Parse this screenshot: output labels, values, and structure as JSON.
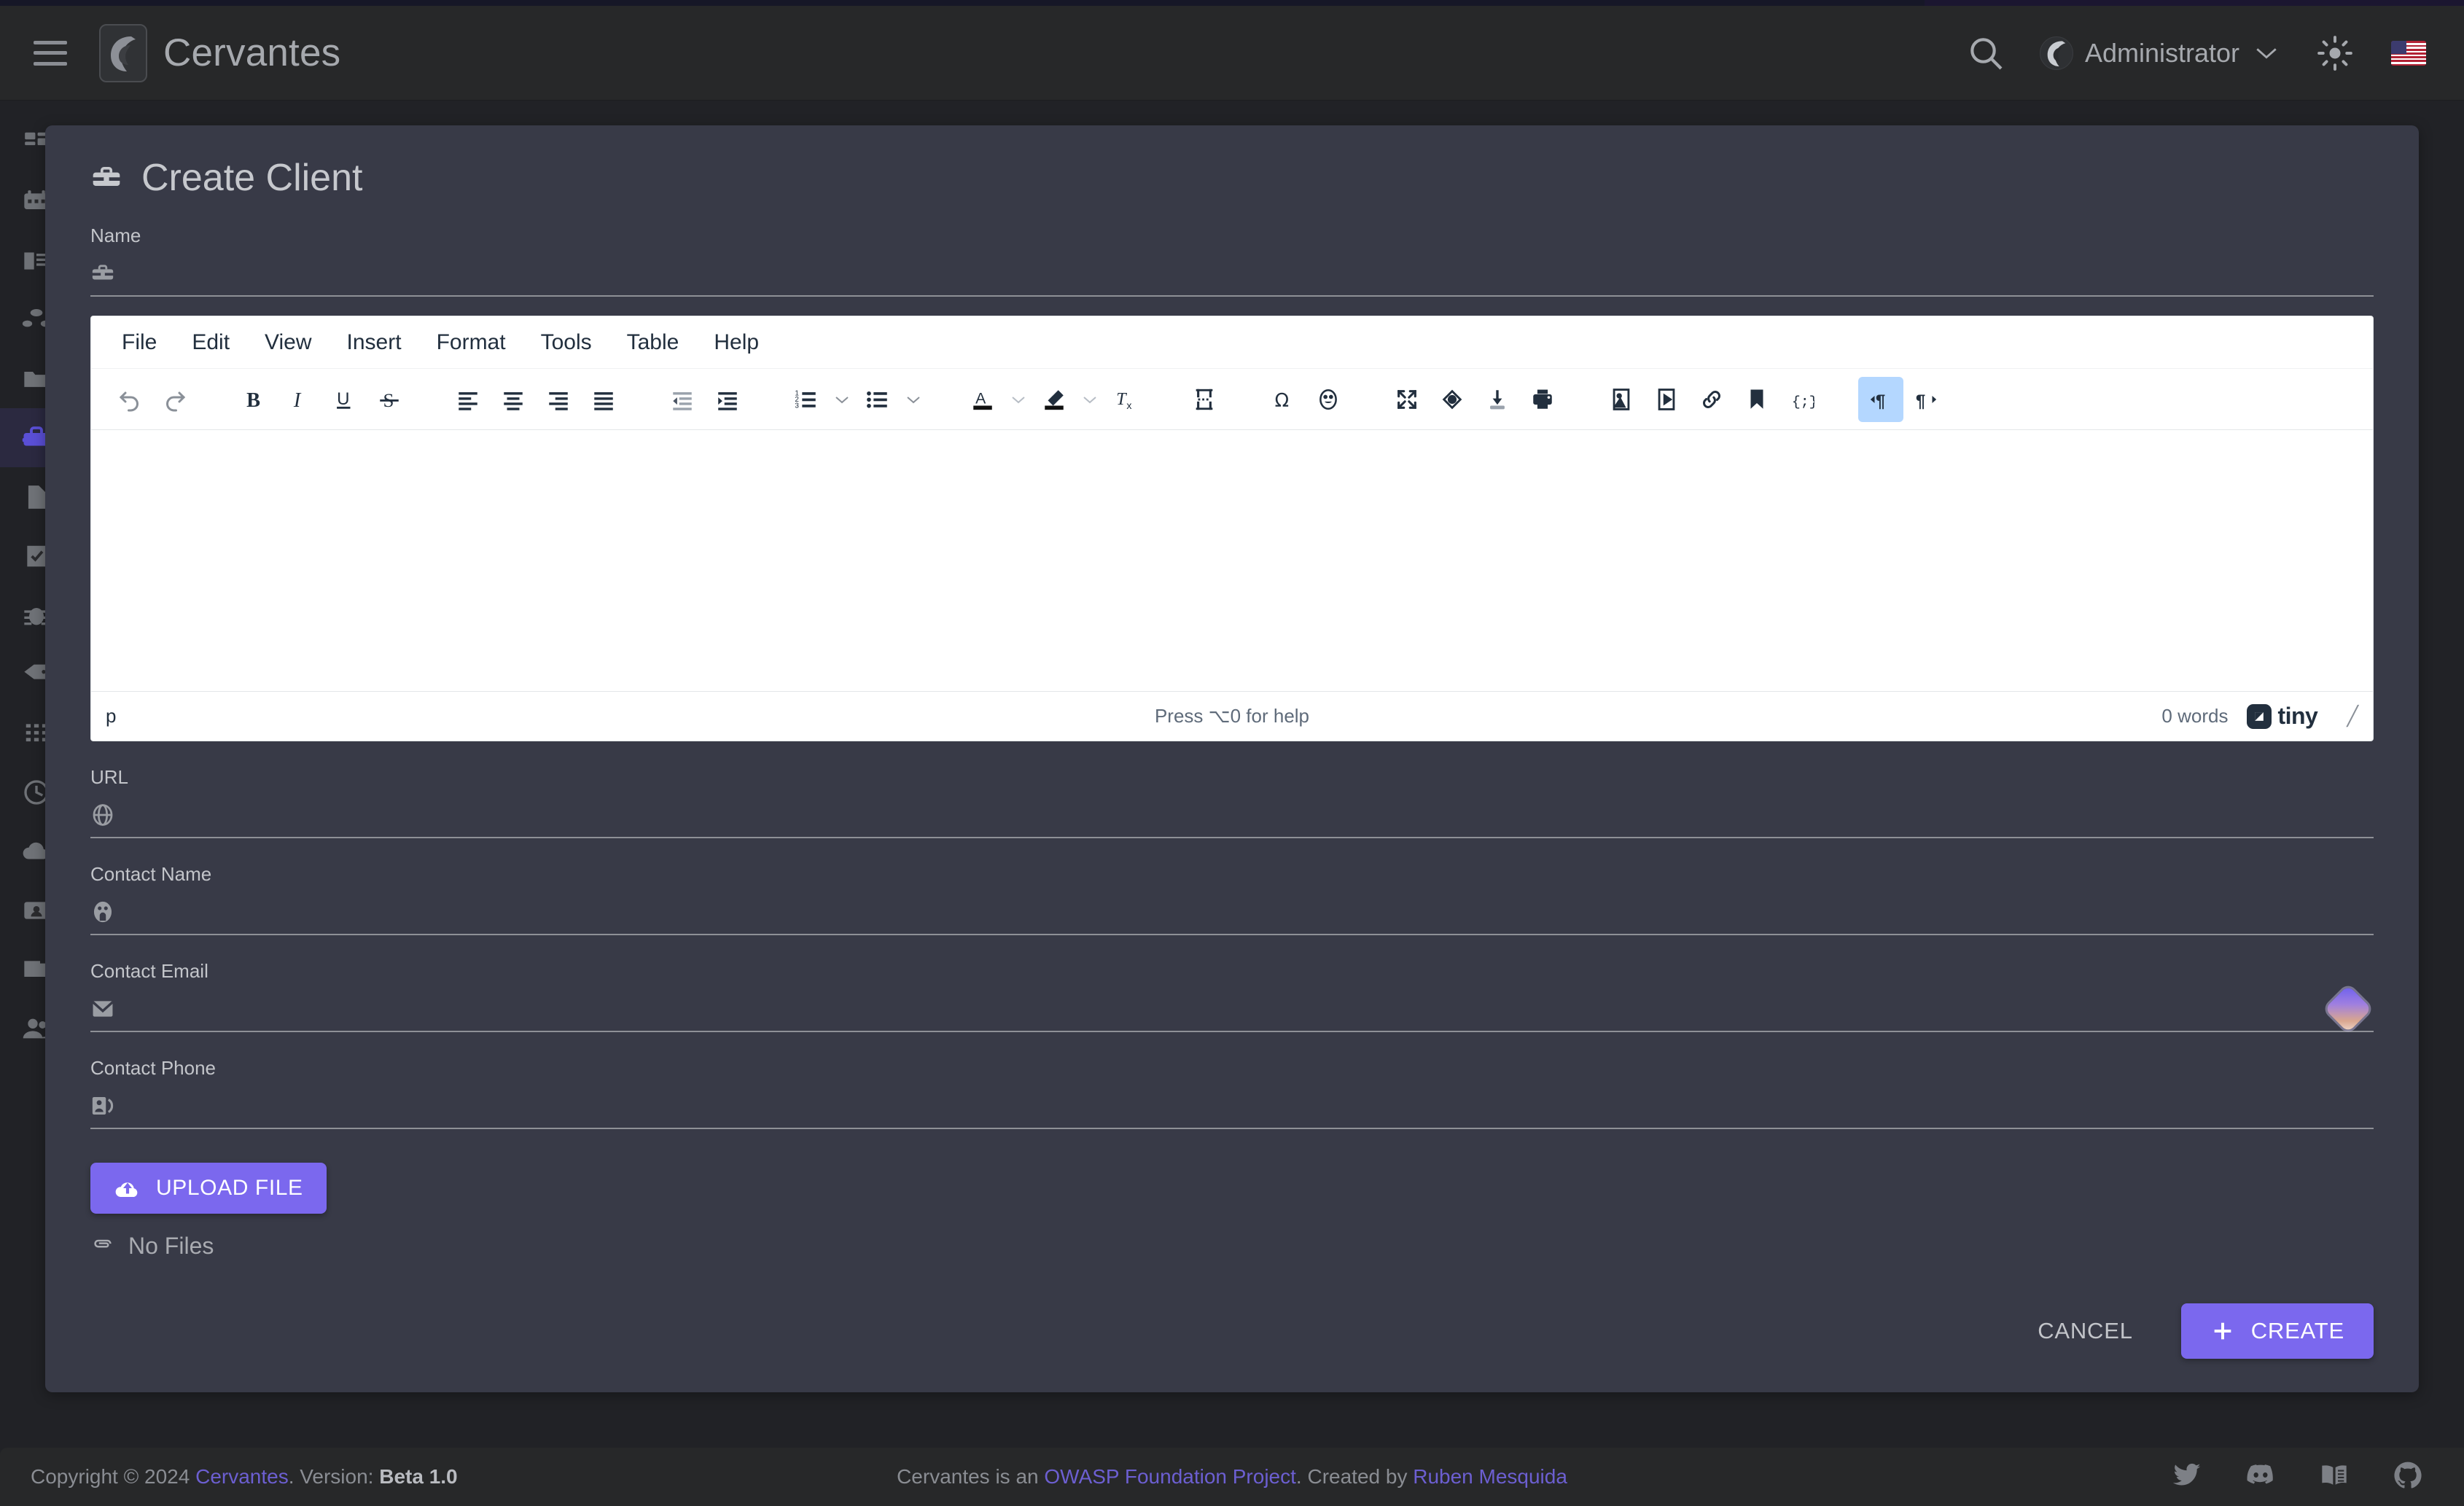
{
  "header": {
    "menu_icon": "hamburger-icon",
    "brand": "Cervantes",
    "search_icon": "search-icon",
    "user": "Administrator",
    "chevron": "chevron-down-icon",
    "theme_icon": "sun-icon",
    "language_flag": "us-flag-icon"
  },
  "sidebar": {
    "items": [
      {
        "name": "dashboard",
        "icon": "dashboard-grid-icon",
        "active": false
      },
      {
        "name": "calendar",
        "icon": "calendar-icon",
        "active": false
      },
      {
        "name": "projects",
        "icon": "book-icon",
        "active": false
      },
      {
        "name": "network",
        "icon": "nodes-icon",
        "active": false
      },
      {
        "name": "folders",
        "icon": "folder-icon",
        "active": false
      },
      {
        "name": "clients",
        "icon": "briefcase-icon",
        "active": true
      },
      {
        "name": "documents",
        "icon": "document-icon",
        "active": false
      },
      {
        "name": "checklists",
        "icon": "document-check-icon",
        "active": false
      },
      {
        "name": "vulnerabilities",
        "icon": "bug-icon",
        "active": false
      },
      {
        "name": "tags",
        "icon": "tag-icon",
        "active": false
      },
      {
        "name": "apps",
        "icon": "grid-dots-icon",
        "active": false
      },
      {
        "name": "history",
        "icon": "clock-icon",
        "active": false
      },
      {
        "name": "uploads",
        "icon": "cloud-upload-icon",
        "active": false
      },
      {
        "name": "id-cards",
        "icon": "id-card-icon",
        "active": false
      },
      {
        "name": "reports",
        "icon": "reports-icon",
        "active": false
      },
      {
        "name": "users",
        "icon": "users-icon",
        "active": false
      }
    ]
  },
  "page": {
    "title": "Create Client",
    "title_icon": "briefcase-icon"
  },
  "form": {
    "fields": [
      {
        "label": "Name",
        "icon": "briefcase-icon",
        "value": "",
        "placeholder": ""
      },
      {
        "label": "URL",
        "icon": "globe-icon",
        "value": "",
        "placeholder": ""
      },
      {
        "label": "Contact Name",
        "icon": "contact-face-icon",
        "value": "",
        "placeholder": ""
      },
      {
        "label": "Contact Email",
        "icon": "envelope-icon",
        "value": "",
        "placeholder": ""
      },
      {
        "label": "Contact Phone",
        "icon": "contact-card-icon",
        "value": "",
        "placeholder": ""
      }
    ],
    "grammar_badge": "grammarly-diamond-icon",
    "upload_button": "UPLOAD FILE",
    "upload_icon": "cloud-upload-icon",
    "files_icon": "paperclip-icon",
    "files_status": "No Files",
    "cancel_button": "CANCEL",
    "create_button": "CREATE",
    "create_icon": "plus-icon"
  },
  "editor": {
    "menus": [
      "File",
      "Edit",
      "View",
      "Insert",
      "Format",
      "Tools",
      "Table",
      "Help"
    ],
    "toolbar": [
      {
        "name": "undo-icon",
        "type": "btn",
        "active": false
      },
      {
        "name": "redo-icon",
        "type": "btn",
        "active": false
      },
      {
        "name": "gap",
        "type": "gap"
      },
      {
        "name": "bold-icon",
        "type": "btn",
        "active": false
      },
      {
        "name": "italic-icon",
        "type": "btn",
        "active": false
      },
      {
        "name": "underline-icon",
        "type": "btn",
        "active": false
      },
      {
        "name": "strikethrough-icon",
        "type": "btn",
        "active": false
      },
      {
        "name": "gap",
        "type": "gap"
      },
      {
        "name": "align-left-icon",
        "type": "btn",
        "active": false
      },
      {
        "name": "align-center-icon",
        "type": "btn",
        "active": false
      },
      {
        "name": "align-right-icon",
        "type": "btn",
        "active": false
      },
      {
        "name": "align-justify-icon",
        "type": "btn",
        "active": false
      },
      {
        "name": "gap",
        "type": "gap"
      },
      {
        "name": "outdent-icon",
        "type": "btn",
        "active": false
      },
      {
        "name": "indent-icon",
        "type": "btn",
        "active": false
      },
      {
        "name": "gap",
        "type": "gap"
      },
      {
        "name": "numbered-list-icon",
        "type": "btn",
        "active": false
      },
      {
        "name": "numbered-list-chevron-down-icon",
        "type": "caret"
      },
      {
        "name": "bullet-list-icon",
        "type": "btn",
        "active": false
      },
      {
        "name": "bullet-list-chevron-down-icon",
        "type": "caret"
      },
      {
        "name": "gap",
        "type": "gap"
      },
      {
        "name": "text-color-icon",
        "type": "btn",
        "active": false
      },
      {
        "name": "text-color-chevron-down-icon",
        "type": "caret"
      },
      {
        "name": "highlight-color-icon",
        "type": "btn",
        "active": false
      },
      {
        "name": "highlight-chevron-down-icon",
        "type": "caret"
      },
      {
        "name": "clear-formatting-icon",
        "type": "btn",
        "active": false
      },
      {
        "name": "gap",
        "type": "gap"
      },
      {
        "name": "page-break-icon",
        "type": "btn",
        "active": false
      },
      {
        "name": "gap",
        "type": "gap"
      },
      {
        "name": "special-character-icon",
        "type": "btn",
        "active": false
      },
      {
        "name": "emoji-icon",
        "type": "btn",
        "active": false
      },
      {
        "name": "gap",
        "type": "gap"
      },
      {
        "name": "fullscreen-icon",
        "type": "btn",
        "active": false
      },
      {
        "name": "preview-icon",
        "type": "btn",
        "active": false
      },
      {
        "name": "export-icon",
        "type": "btn",
        "active": false
      },
      {
        "name": "print-icon",
        "type": "btn",
        "active": false
      },
      {
        "name": "gap",
        "type": "gap"
      },
      {
        "name": "insert-image-icon",
        "type": "btn",
        "active": false
      },
      {
        "name": "insert-media-icon",
        "type": "btn",
        "active": false
      },
      {
        "name": "insert-link-icon",
        "type": "btn",
        "active": false
      },
      {
        "name": "anchor-icon",
        "type": "btn",
        "active": false
      },
      {
        "name": "source-code-icon",
        "type": "btn",
        "active": false
      },
      {
        "name": "gap",
        "type": "gap"
      },
      {
        "name": "ltr-icon",
        "type": "btn",
        "active": true
      },
      {
        "name": "rtl-icon",
        "type": "btn",
        "active": false
      }
    ],
    "content": "",
    "status_path": "p",
    "help_text": "Press ⌥0 for help",
    "word_count": "0 words",
    "brand": "tiny",
    "brand_icon": "tinymce-logo-icon",
    "resize_icon": "resize-grip-icon"
  },
  "footer": {
    "copyright_prefix": "Copyright © 2024 ",
    "copyright_link": "Cervantes",
    "version_label": ". Version: ",
    "version_value": "Beta 1.0",
    "center_prefix": "Cervantes is an ",
    "center_link1": "OWASP Foundation Project",
    "center_mid": ". Created by ",
    "center_link2": "Ruben Mesquida",
    "social": [
      {
        "name": "twitter-icon"
      },
      {
        "name": "discord-icon"
      },
      {
        "name": "docs-book-icon"
      },
      {
        "name": "github-icon"
      }
    ]
  },
  "colors": {
    "accent": "#7b68ee",
    "card_bg": "#383a47",
    "page_bg": "#212226",
    "header_bg": "#272829",
    "link": "#6c5fd1"
  }
}
